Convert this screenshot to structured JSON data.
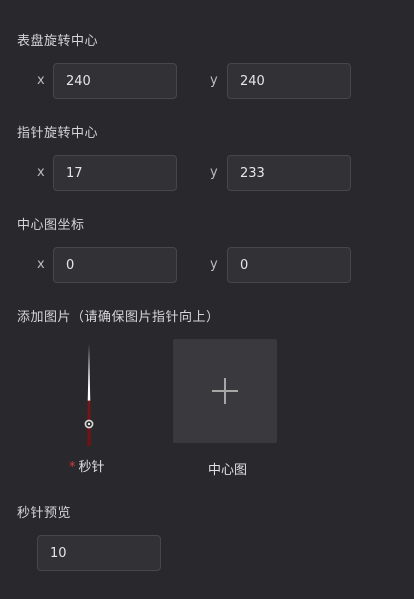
{
  "dial_center": {
    "title": "表盘旋转中心",
    "x_label": "x",
    "x_value": "240",
    "y_label": "y",
    "y_value": "240"
  },
  "pointer_center": {
    "title": "指针旋转中心",
    "x_label": "x",
    "x_value": "17",
    "y_label": "y",
    "y_value": "233"
  },
  "center_image_coords": {
    "title": "中心图坐标",
    "x_label": "x",
    "x_value": "0",
    "y_label": "y",
    "y_value": "0"
  },
  "add_image": {
    "title": "添加图片（请确保图片指针向上）",
    "second_hand": {
      "required_mark": "*",
      "label": "秒针"
    },
    "center_image": {
      "label": "中心图",
      "icon": "plus-icon"
    }
  },
  "second_preview": {
    "title": "秒针预览",
    "value": "10"
  },
  "colors": {
    "background": "#28282d",
    "input_bg": "#323236",
    "required": "#d63a3a",
    "needle": "#8b1a1a"
  }
}
